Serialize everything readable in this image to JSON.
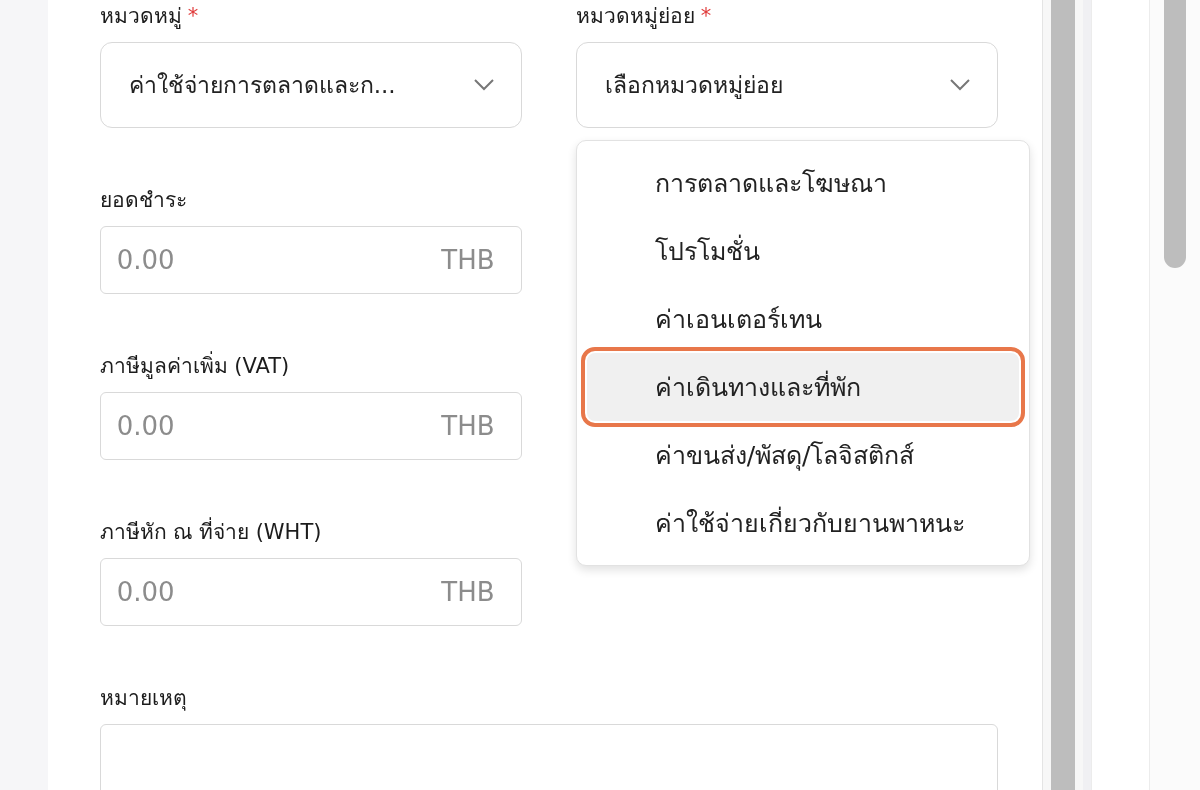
{
  "category": {
    "label": "หมวดหมู่",
    "required_mark": "*",
    "value": "ค่าใช้จ่ายการตลาดและก..."
  },
  "subcategory": {
    "label": "หมวดหมู่ย่อย",
    "required_mark": "*",
    "placeholder": "เลือกหมวดหมู่ย่อย",
    "options": [
      {
        "label": "การตลาดและโฆษณา",
        "selected": false
      },
      {
        "label": "โปรโมชั่น",
        "selected": false
      },
      {
        "label": "ค่าเอนเตอร์เทน",
        "selected": false
      },
      {
        "label": "ค่าเดินทางและที่พัก",
        "selected": true
      },
      {
        "label": "ค่าขนส่ง/พัสดุ/โลจิสติกส์",
        "selected": false
      },
      {
        "label": "ค่าใช้จ่ายเกี่ยวกับยานพาหนะ",
        "selected": false
      }
    ]
  },
  "amounts": [
    {
      "label": "ยอดชำระ",
      "placeholder": "0.00",
      "currency": "THB"
    },
    {
      "label": "ภาษีมูลค่าเพิ่ม (VAT)",
      "placeholder": "0.00",
      "currency": "THB"
    },
    {
      "label": "ภาษีหัก ณ ที่จ่าย (WHT)",
      "placeholder": "0.00",
      "currency": "THB"
    }
  ],
  "note": {
    "label": "หมายเหตุ"
  }
}
